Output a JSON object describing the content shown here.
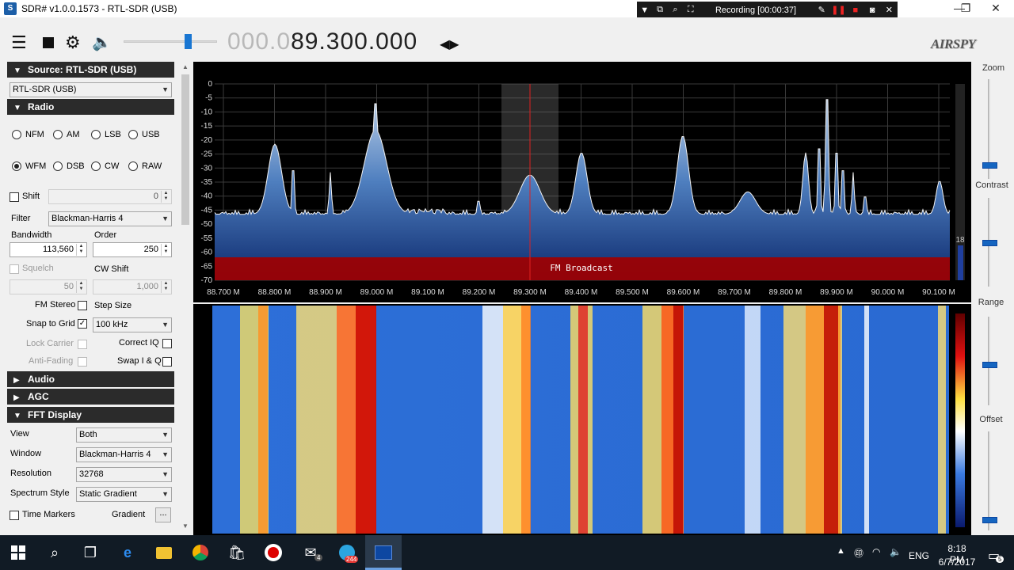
{
  "window": {
    "title": "SDR# v1.0.0.1573 - RTL-SDR (USB)",
    "min": "—",
    "max": "❐",
    "close": "✕"
  },
  "recording": {
    "status": "Recording [00:00:37]"
  },
  "toolbar": {
    "freq_dim": "000.0",
    "freq_main": "89.300.000",
    "logo": "AIRSPY"
  },
  "source": {
    "header": "Source: RTL-SDR (USB)",
    "device": "RTL-SDR (USB)"
  },
  "radio": {
    "header": "Radio",
    "modes": [
      "NFM",
      "AM",
      "LSB",
      "USB",
      "WFM",
      "DSB",
      "CW",
      "RAW"
    ],
    "selected_mode": "WFM",
    "shift_label": "Shift",
    "shift_value": "0",
    "filter_label": "Filter",
    "filter_value": "Blackman-Harris 4",
    "bandwidth_label": "Bandwidth",
    "bandwidth_value": "113,560",
    "order_label": "Order",
    "order_value": "250",
    "squelch_label": "Squelch",
    "squelch_value": "50",
    "cwshift_label": "CW Shift",
    "cwshift_value": "1,000",
    "fmstereo_label": "FM Stereo",
    "stepsize_label": "Step Size",
    "snap_label": "Snap to Grid",
    "step_value": "100 kHz",
    "lockcarrier_label": "Lock Carrier",
    "correctiq_label": "Correct IQ",
    "antifading_label": "Anti-Fading",
    "swapiq_label": "Swap I & Q"
  },
  "audio": {
    "header": "Audio"
  },
  "agc": {
    "header": "AGC"
  },
  "fft": {
    "header": "FFT Display",
    "view_label": "View",
    "view_value": "Both",
    "window_label": "Window",
    "window_value": "Blackman-Harris 4",
    "resolution_label": "Resolution",
    "resolution_value": "32768",
    "style_label": "Spectrum Style",
    "style_value": "Static Gradient",
    "timemarkers_label": "Time Markers",
    "gradient_label": "Gradient",
    "gradient_btn": "..."
  },
  "spectrum": {
    "band_label": "FM Broadcast",
    "db_labels": [
      "0",
      "-5",
      "-10",
      "-15",
      "-20",
      "-25",
      "-30",
      "-35",
      "-40",
      "-45",
      "-50",
      "-55",
      "-60",
      "-65",
      "-70"
    ],
    "freq_labels": [
      "88.700 M",
      "88.800 M",
      "88.900 M",
      "89.000 M",
      "89.100 M",
      "89.200 M",
      "89.300 M",
      "89.400 M",
      "89.500 M",
      "89.600 M",
      "89.700 M",
      "89.800 M",
      "89.900 M",
      "90.000 M",
      "90.100 M"
    ],
    "level_value": "18"
  },
  "right_panel": {
    "zoom": "Zoom",
    "contrast": "Contrast",
    "range": "Range",
    "offset": "Offset"
  },
  "taskbar": {
    "lang": "ENG",
    "time": "8:18 PM",
    "date": "6/7/2017",
    "mail_badge": "4",
    "telegram_badge": "244",
    "notif_badge": "5"
  },
  "colors": {
    "spectrum_fill_top": "#b9cde6",
    "spectrum_fill_bottom": "#0d2a6e",
    "band_red": "#a00000",
    "taskbar": "#111b25",
    "accent": "#1565c0"
  }
}
